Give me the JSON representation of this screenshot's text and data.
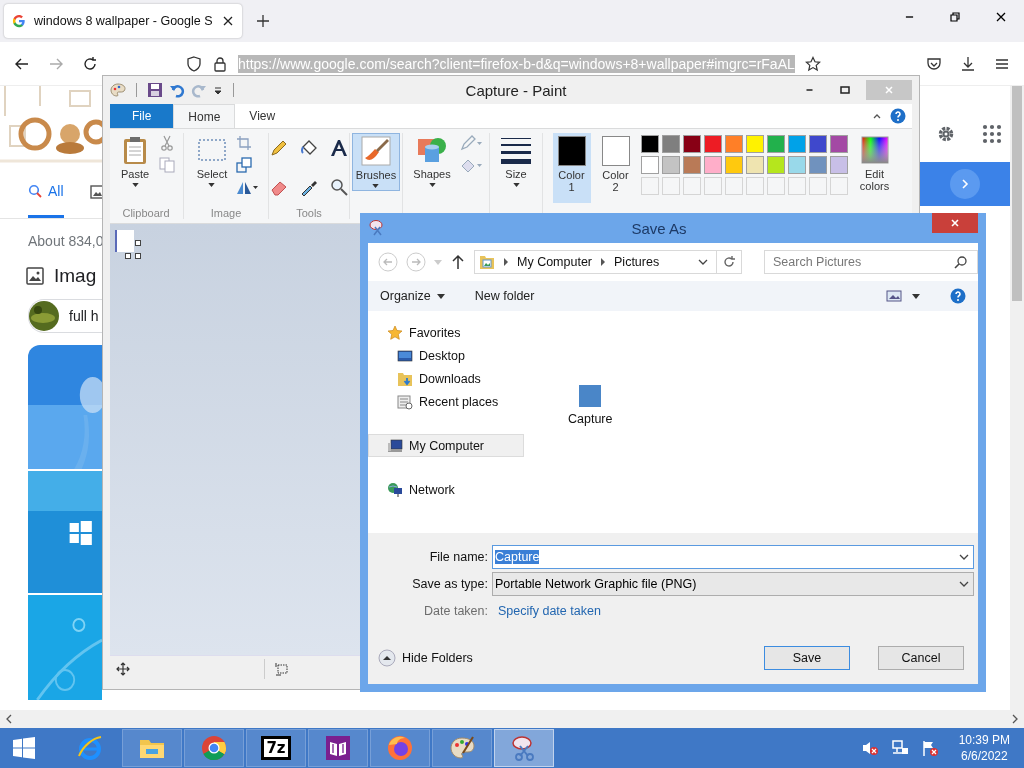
{
  "browser": {
    "tab_title": "windows 8 wallpaper - Google S",
    "url": "https://www.google.com/search?client=firefox-b-d&q=windows+8+wallpaper#imgrc=rFaAL"
  },
  "google": {
    "tabs": [
      {
        "label": "All",
        "selected": true
      }
    ],
    "result_count": "About 834,0",
    "images_heading": "Imag",
    "chip": "full h"
  },
  "paint": {
    "title": "Capture - Paint",
    "tabs": [
      {
        "label": "File",
        "kind": "file",
        "selected": false
      },
      {
        "label": "Home",
        "kind": "tab",
        "selected": true
      },
      {
        "label": "View",
        "kind": "tab",
        "selected": false
      }
    ],
    "groups": [
      "Clipboard",
      "Image",
      "Tools"
    ],
    "paste": "Paste",
    "select": "Select",
    "brushes": {
      "label": "Brushes",
      "selected": true
    },
    "shapes": "Shapes",
    "size": "Size",
    "colors": [
      {
        "label": "Color 1",
        "selected": true,
        "color": "#000000"
      },
      {
        "label": "Color 2",
        "selected": false,
        "color": "#ffffff"
      }
    ],
    "palette": [
      {
        "color": "#000000"
      },
      {
        "color": "#7f7f7f"
      },
      {
        "color": "#880015"
      },
      {
        "color": "#ed1c24"
      },
      {
        "color": "#ff7f27"
      },
      {
        "color": "#fff200"
      },
      {
        "color": "#22b14c"
      },
      {
        "color": "#00a2e8"
      },
      {
        "color": "#3f48cc"
      },
      {
        "color": "#a349a4"
      },
      {
        "color": "#ffffff"
      },
      {
        "color": "#c3c3c3"
      },
      {
        "color": "#b97a57"
      },
      {
        "color": "#ffaec9"
      },
      {
        "color": "#ffc90e"
      },
      {
        "color": "#efe4b0"
      },
      {
        "color": "#b5e61d"
      },
      {
        "color": "#99d9ea"
      },
      {
        "color": "#7092be"
      },
      {
        "color": "#c8bfe7"
      }
    ],
    "edit_colors": "Edit colors"
  },
  "save_dialog": {
    "title": "Save As",
    "breadcrumb": [
      "My Computer",
      "Pictures"
    ],
    "search": {
      "placeholder": "Search Pictures"
    },
    "organize": "Organize",
    "new_folder": "New folder",
    "nav": [
      {
        "label": "Favorites",
        "kind": "favorites",
        "selected": false,
        "children": [
          {
            "label": "Desktop",
            "kind": "desktop",
            "selected": false
          },
          {
            "label": "Downloads",
            "kind": "downloads",
            "selected": false
          },
          {
            "label": "Recent places",
            "kind": "recent",
            "selected": false
          }
        ]
      },
      {
        "label": "My Computer",
        "kind": "computer",
        "selected": true
      },
      {
        "label": "Network",
        "kind": "network",
        "selected": false
      }
    ],
    "files": [
      {
        "name": "Capture"
      }
    ],
    "file_name": {
      "label": "File name:",
      "value": "Capture"
    },
    "save_type": {
      "label": "Save as type:",
      "value": "Portable Network Graphic file (PNG)"
    },
    "date_taken": {
      "label": "Date taken:",
      "link": "Specify date taken"
    },
    "hide_folders": "Hide Folders",
    "buttons": [
      {
        "label": "Save",
        "kind": "default"
      },
      {
        "label": "Cancel",
        "kind": "normal"
      }
    ]
  },
  "taskbar": {
    "apps": [
      {
        "kind": "ie",
        "selected": false
      },
      {
        "kind": "explorer",
        "selected": false
      },
      {
        "kind": "chrome",
        "selected": false
      },
      {
        "kind": "sevenzip",
        "label": "7z",
        "selected": false
      },
      {
        "kind": "purple",
        "selected": false
      },
      {
        "kind": "firefox",
        "selected": false
      },
      {
        "kind": "paint",
        "selected": false
      },
      {
        "kind": "snip",
        "selected": true
      }
    ],
    "time": "10:39 PM",
    "date": "6/6/2022"
  }
}
